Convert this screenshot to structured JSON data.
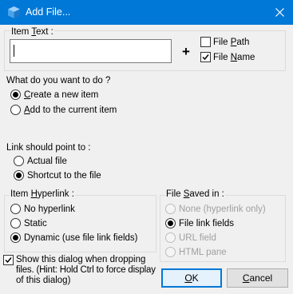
{
  "window": {
    "title": "Add File...",
    "close_glyph": "✕"
  },
  "item_text": {
    "label_prefix": "Item ",
    "label_accel": "T",
    "label_suffix": "ext :",
    "value": "",
    "plus": "+",
    "file_path": {
      "prefix": "File ",
      "accel": "P",
      "suffix": "ath",
      "checked": false
    },
    "file_name": {
      "prefix": "File ",
      "accel": "N",
      "suffix": "ame",
      "checked": true
    }
  },
  "action": {
    "question": "What do you want to do ?",
    "create": {
      "accel": "C",
      "rest": "reate a new item",
      "checked": true
    },
    "add": {
      "accel": "A",
      "rest": "dd to the current item",
      "checked": false
    }
  },
  "link": {
    "title": "Link should point to :",
    "actual": {
      "label": "Actual file",
      "checked": false
    },
    "shortcut": {
      "label": "Shortcut to the file",
      "checked": true
    }
  },
  "hyperlink": {
    "title_prefix": "Item ",
    "title_accel": "H",
    "title_suffix": "yperlink :",
    "none": {
      "label": "No hyperlink",
      "checked": false
    },
    "static": {
      "label": "Static",
      "checked": false
    },
    "dynamic": {
      "label": "Dynamic (use file link fields)",
      "checked": true
    }
  },
  "saved_in": {
    "title_prefix": "File ",
    "title_accel": "S",
    "title_suffix": "aved in :",
    "none": {
      "label": "None (hyperlink only)",
      "checked": false,
      "disabled": true
    },
    "link_fields": {
      "label": "File link fields",
      "checked": true,
      "disabled": false
    },
    "url": {
      "label": "URL field",
      "checked": false,
      "disabled": true
    },
    "html": {
      "label": "HTML pane",
      "checked": false,
      "disabled": true
    }
  },
  "show_dialog": {
    "line1": "Show this dialog when dropping",
    "line2": "files. (Hint: Hold Ctrl to force display",
    "line3": "of this dialog)",
    "checked": true
  },
  "buttons": {
    "ok": {
      "accel": "O",
      "rest": "K"
    },
    "cancel": {
      "accel": "C",
      "rest": "ancel"
    }
  },
  "colors": {
    "titlebar": "#0078d7",
    "default_border": "#0078d7",
    "background": "#f0f0f0"
  },
  "icons": {
    "app": "cube-icon",
    "close": "close-icon",
    "check": "check-icon"
  }
}
